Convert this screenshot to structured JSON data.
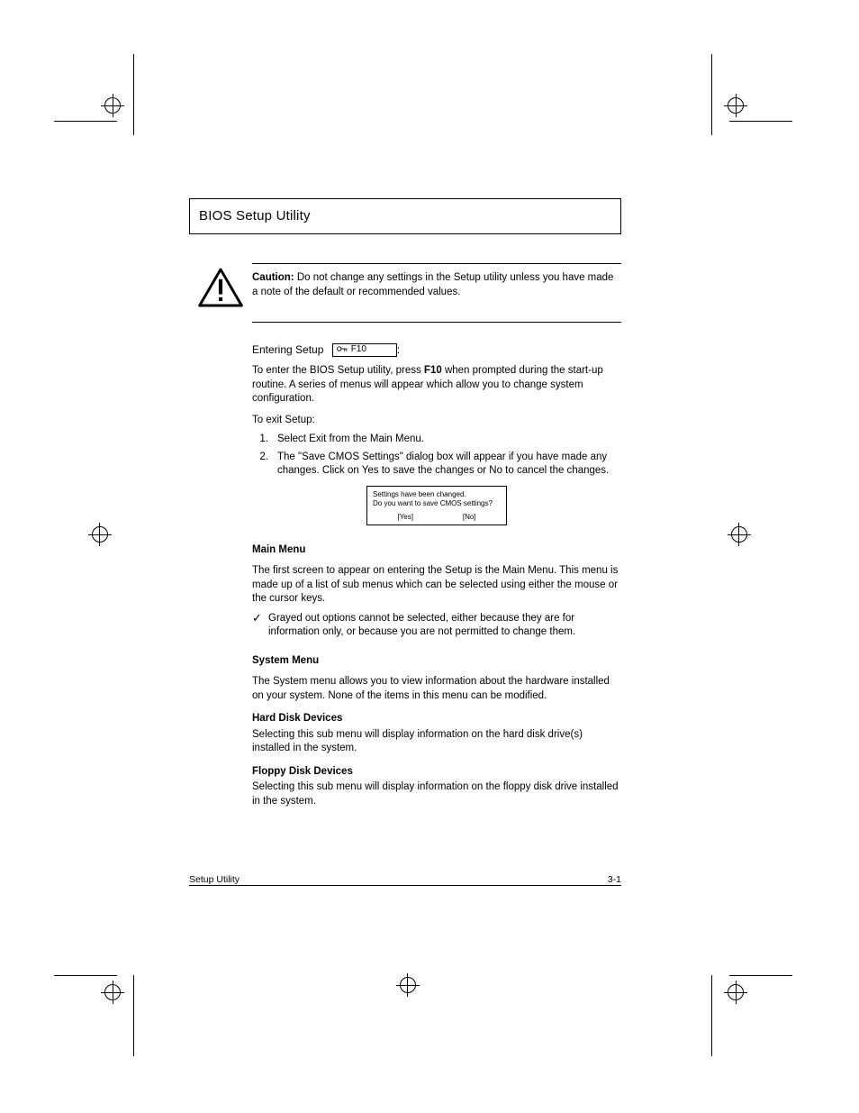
{
  "heading": "BIOS Setup Utility",
  "caution": {
    "label": "Caution:",
    "text": "Do not change any settings in the Setup utility unless you have made a note of the default or recommended values."
  },
  "subhead_prefix": "Entering Setup",
  "subhead_suffix": ":",
  "key_label": "F10",
  "p1_pre": "To enter the BIOS Setup utility, press ",
  "p1_mid": " when prompted ",
  "p1_post": "during the start-up routine. A series of menus will appear which allow you to change system configuration.",
  "exit_list": {
    "intro": "To exit Setup:",
    "items": [
      "Select Exit from the Main Menu.",
      "The \"Save CMOS Settings\" dialog box will appear if you have made any changes. Click on Yes to save the changes or No to cancel the changes."
    ]
  },
  "dialog": {
    "line1": "Settings have been changed.",
    "line2": "Do you want to save CMOS settings?",
    "yes": "[Yes]",
    "no": "[No]"
  },
  "main_menu": {
    "title": "Main Menu",
    "body": "The first screen to appear on entering the Setup is the Main Menu. This menu is made up of a list of sub menus which can be selected using either the mouse or the cursor keys.",
    "note": "Grayed out options cannot be selected, either because they are for information only, or because you are not permitted to change them."
  },
  "system_menu": {
    "title": "System Menu",
    "body": "The System menu allows you to view information about the hardware installed on your system. None of the items in this menu can be modified.",
    "hdd_label": "Hard Disk Devices",
    "hdd_body": "Selecting this sub menu will display information on the hard disk drive(s) installed in the system.",
    "fdd_label": "Floppy Disk Devices",
    "fdd_body": "Selecting this sub menu will display information on the floppy disk drive installed in the system."
  },
  "footer": {
    "left": "Setup Utility",
    "right": "3-1"
  }
}
